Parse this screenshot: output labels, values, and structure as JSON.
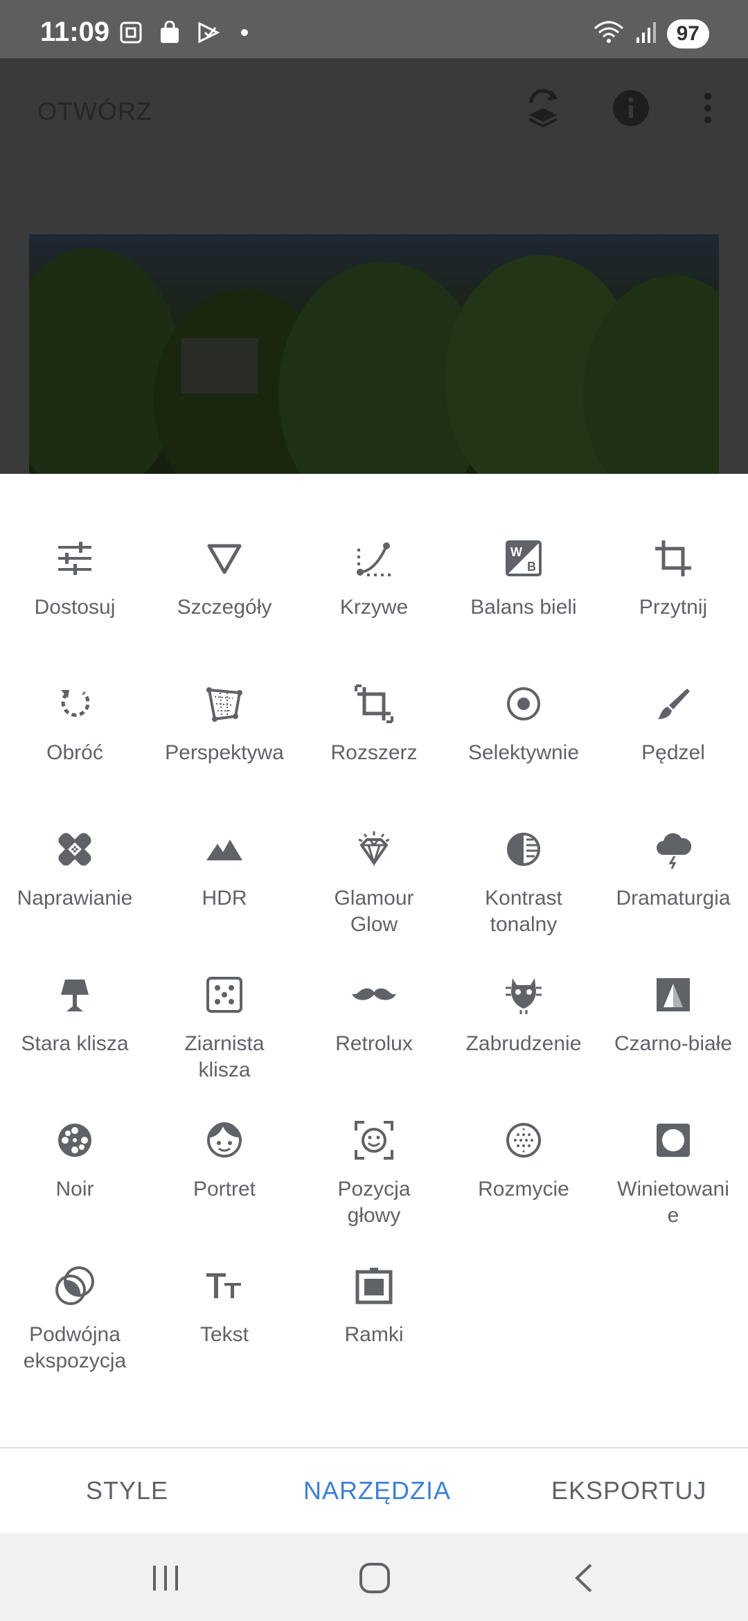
{
  "status_bar": {
    "time": "11:09",
    "battery": "97",
    "left_icons": [
      "screenshot-icon",
      "bag-icon",
      "play-store-icon"
    ],
    "right_icons": [
      "wifi-icon",
      "signal-icon"
    ]
  },
  "editor": {
    "open_label": "OTWÓRZ",
    "top_icons": [
      "layers-icon",
      "info-icon",
      "more-vert-icon"
    ]
  },
  "tools": [
    {
      "label": "Dostosuj",
      "icon": "tune-icon"
    },
    {
      "label": "Szczegóły",
      "icon": "triangle-icon"
    },
    {
      "label": "Krzywe",
      "icon": "curves-icon"
    },
    {
      "label": "Balans bieli",
      "icon": "white-balance-icon"
    },
    {
      "label": "Przytnij",
      "icon": "crop-icon"
    },
    {
      "label": "Obróć",
      "icon": "rotate-icon"
    },
    {
      "label": "Perspektywa",
      "icon": "perspective-icon"
    },
    {
      "label": "Rozszerz",
      "icon": "expand-icon"
    },
    {
      "label": "Selektywnie",
      "icon": "selective-icon"
    },
    {
      "label": "Pędzel",
      "icon": "brush-icon"
    },
    {
      "label": "Naprawianie",
      "icon": "healing-icon"
    },
    {
      "label": "HDR",
      "icon": "mountains-icon"
    },
    {
      "label": "Glamour\nGlow",
      "icon": "diamond-icon"
    },
    {
      "label": "Kontrast\ntonalny",
      "icon": "tonal-contrast-icon"
    },
    {
      "label": "Dramaturgia",
      "icon": "storm-cloud-icon"
    },
    {
      "label": "Stara klisza",
      "icon": "lamp-icon"
    },
    {
      "label": "Ziarnista\nklisza",
      "icon": "grain-icon"
    },
    {
      "label": "Retrolux",
      "icon": "mustache-icon"
    },
    {
      "label": "Zabrudzenie",
      "icon": "grunge-icon"
    },
    {
      "label": "Czarno-białe",
      "icon": "black-white-icon"
    },
    {
      "label": "Noir",
      "icon": "film-reel-icon"
    },
    {
      "label": "Portret",
      "icon": "face-icon"
    },
    {
      "label": "Pozycja\ngłowy",
      "icon": "face-frame-icon"
    },
    {
      "label": "Rozmycie",
      "icon": "blur-icon"
    },
    {
      "label": "Winietowani\ne",
      "icon": "vignette-icon"
    },
    {
      "label": "Podwójna\nekspozycja",
      "icon": "double-exposure-icon"
    },
    {
      "label": "Tekst",
      "icon": "text-icon"
    },
    {
      "label": "Ramki",
      "icon": "frame-icon"
    }
  ],
  "tabs": [
    {
      "label": "STYLE",
      "active": false
    },
    {
      "label": "NARZĘDZIA",
      "active": true
    },
    {
      "label": "EKSPORTUJ",
      "active": false
    }
  ],
  "navbar": {
    "buttons": [
      "recents-icon",
      "home-icon",
      "back-icon"
    ]
  },
  "colors": {
    "icon": "#5f6368",
    "label": "#5f6368",
    "active_tab": "#3d7fd6",
    "status_bar": "#5e5e5e",
    "scrim": "#3a3a3a"
  }
}
